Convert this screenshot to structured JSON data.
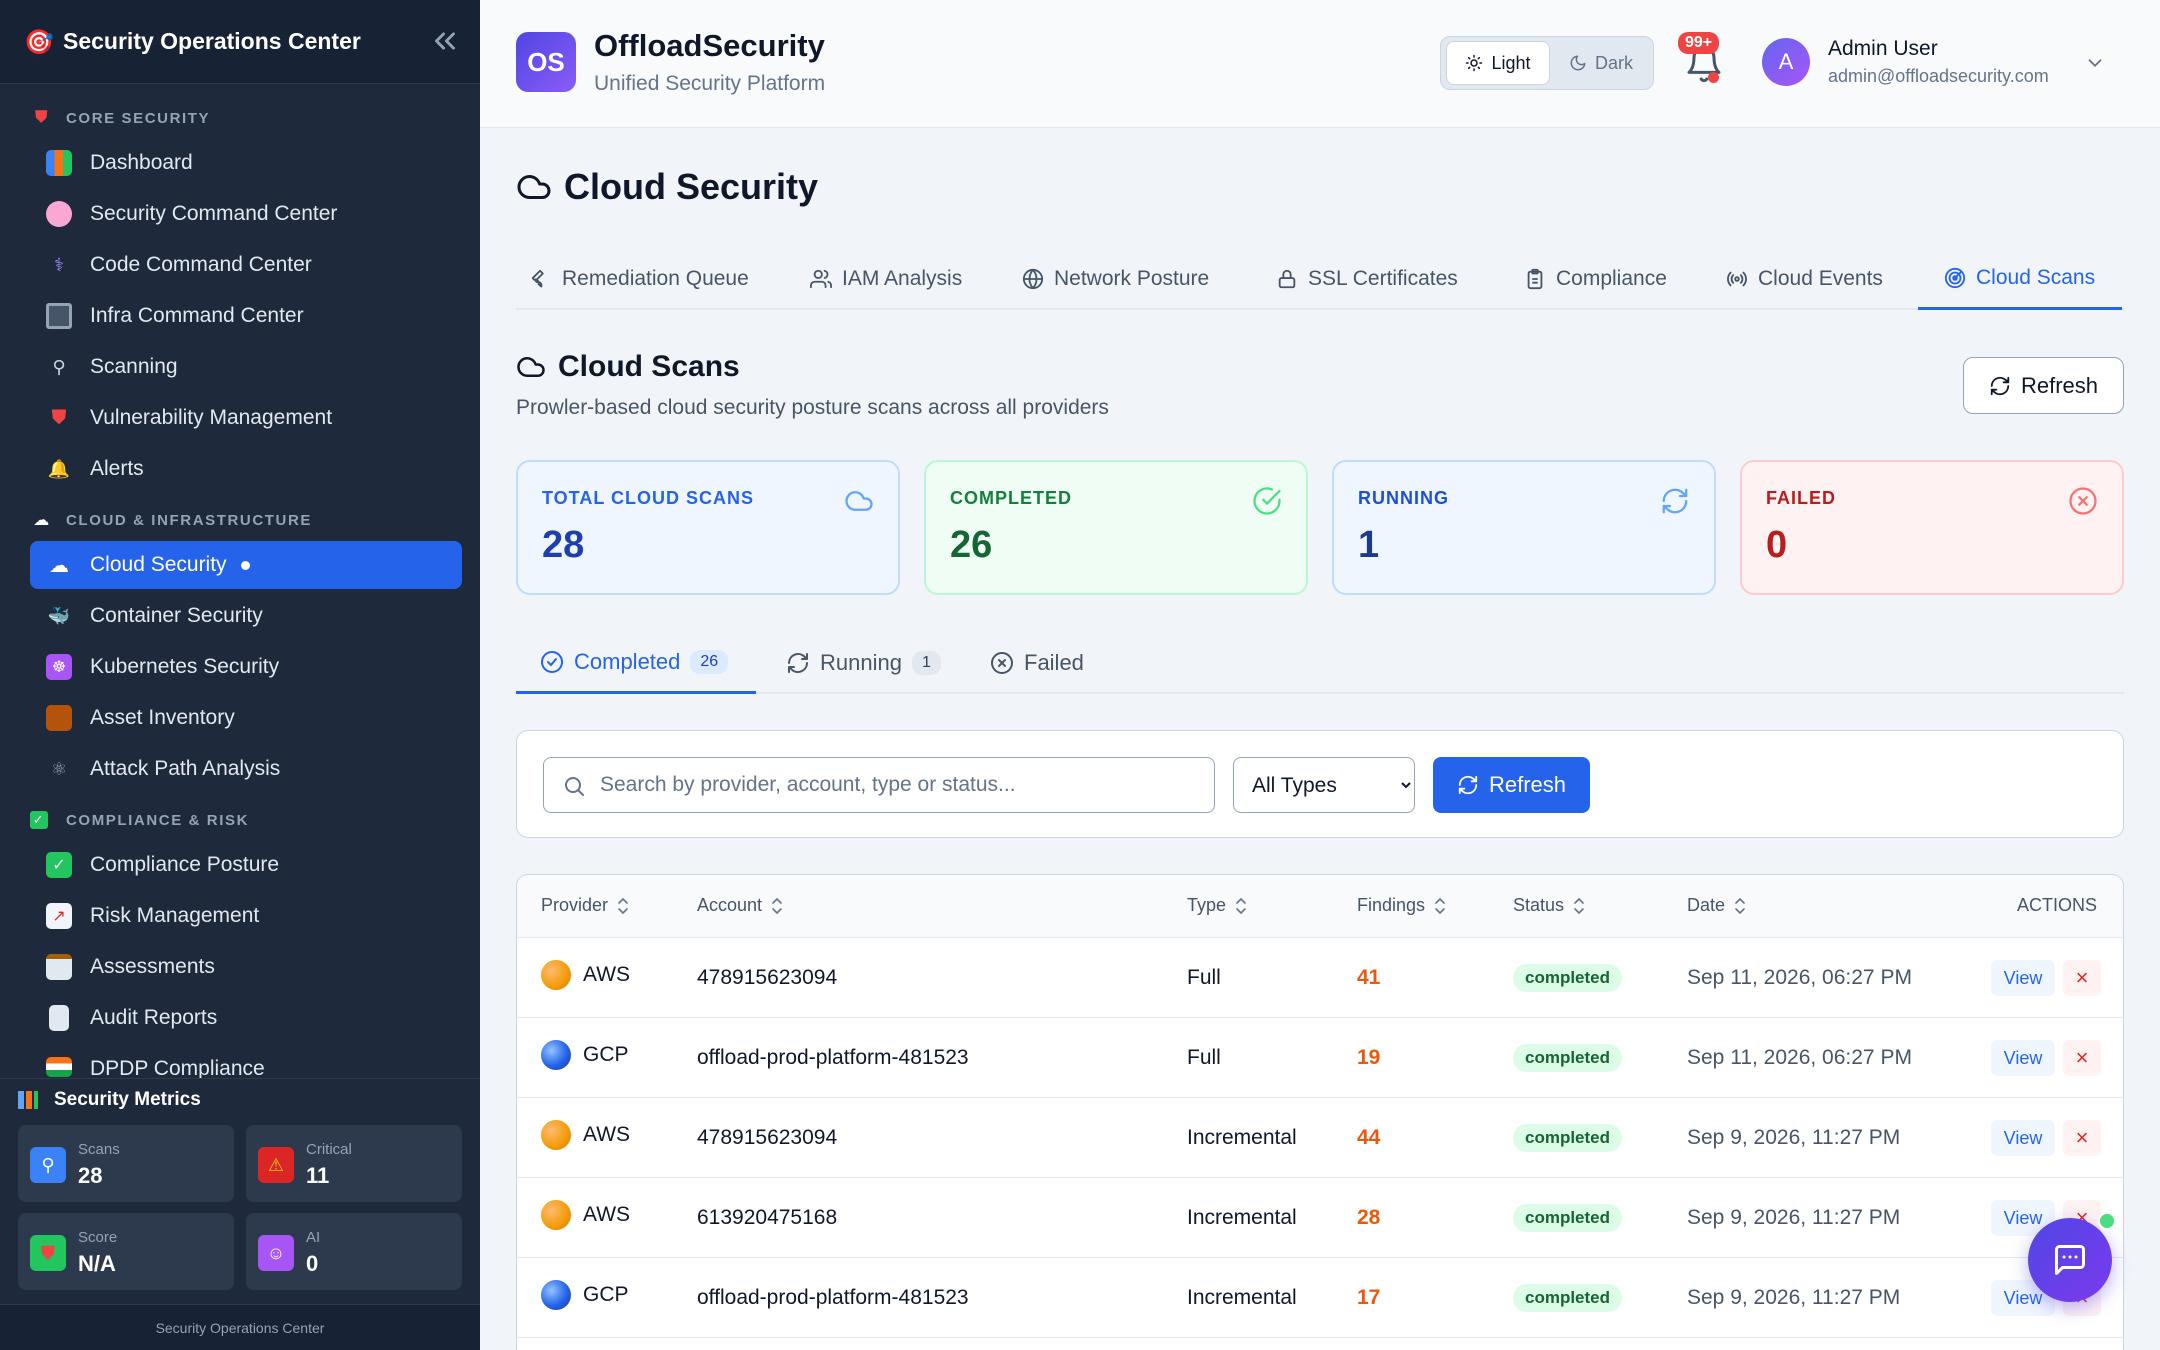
{
  "sidebar": {
    "title": "Security Operations Center",
    "sections": {
      "core": "CORE SECURITY",
      "cloud": "CLOUD & INFRASTRUCTURE",
      "compliance": "COMPLIANCE & RISK"
    },
    "items": [
      {
        "label": "Dashboard",
        "icon": "bar-chart-icon"
      },
      {
        "label": "Security Command Center",
        "icon": "brain-icon"
      },
      {
        "label": "Code Command Center",
        "icon": "dna-icon"
      },
      {
        "label": "Infra Command Center",
        "icon": "monitor-icon"
      },
      {
        "label": "Scanning",
        "icon": "magnifier-icon"
      },
      {
        "label": "Vulnerability Management",
        "icon": "shield-icon"
      },
      {
        "label": "Alerts",
        "icon": "bell-icon"
      },
      {
        "label": "Cloud Security",
        "icon": "cloud-icon"
      },
      {
        "label": "Container Security",
        "icon": "whale-icon"
      },
      {
        "label": "Kubernetes Security",
        "icon": "helm-icon"
      },
      {
        "label": "Asset Inventory",
        "icon": "package-icon"
      },
      {
        "label": "Attack Path Analysis",
        "icon": "atom-icon"
      },
      {
        "label": "Compliance Posture",
        "icon": "check-icon"
      },
      {
        "label": "Risk Management",
        "icon": "trend-chart-icon"
      },
      {
        "label": "Assessments",
        "icon": "clipboard-icon"
      },
      {
        "label": "Audit Reports",
        "icon": "document-icon"
      },
      {
        "label": "DPDP Compliance",
        "icon": "india-flag-icon"
      }
    ],
    "metrics": {
      "title": "Security Metrics",
      "scans_label": "Scans",
      "scans_value": "28",
      "critical_label": "Critical",
      "critical_value": "11",
      "score_label": "Score",
      "score_value": "N/A",
      "ai_label": "AI",
      "ai_value": "0"
    },
    "footer": "Security Operations Center"
  },
  "header": {
    "badge": "OS",
    "brand": "OffloadSecurity",
    "subtitle": "Unified Security Platform",
    "theme_light": "Light",
    "theme_dark": "Dark",
    "notif_count": "99+",
    "user_initial": "A",
    "user_name": "Admin User",
    "user_email": "admin@offloadsecurity.com"
  },
  "main": {
    "title": "Cloud Security",
    "tabs": [
      {
        "label": "Remediation Queue",
        "icon": "wrench-icon"
      },
      {
        "label": "IAM Analysis",
        "icon": "users-icon"
      },
      {
        "label": "Network Posture",
        "icon": "globe-icon"
      },
      {
        "label": "SSL Certificates",
        "icon": "lock-icon"
      },
      {
        "label": "Compliance",
        "icon": "clipboard-icon"
      },
      {
        "label": "Cloud Events",
        "icon": "radio-icon"
      },
      {
        "label": "Cloud Scans",
        "icon": "radar-icon"
      }
    ],
    "section_title": "Cloud Scans",
    "section_desc": "Prowler-based cloud security posture scans across all providers",
    "refresh_label": "Refresh",
    "stats": {
      "total_label": "TOTAL CLOUD SCANS",
      "total_value": "28",
      "completed_label": "COMPLETED",
      "completed_value": "26",
      "running_label": "RUNNING",
      "running_value": "1",
      "failed_label": "FAILED",
      "failed_value": "0"
    },
    "subtabs": {
      "completed_label": "Completed",
      "completed_count": "26",
      "running_label": "Running",
      "running_count": "1",
      "failed_label": "Failed"
    },
    "search_placeholder": "Search by provider, account, type or status...",
    "type_filter": "All Types",
    "filter_refresh": "Refresh",
    "columns": {
      "provider": "Provider",
      "account": "Account",
      "type": "Type",
      "findings": "Findings",
      "status": "Status",
      "date": "Date",
      "actions": "ACTIONS"
    },
    "rows": [
      {
        "provider": "AWS",
        "account": "478915623094",
        "type": "Full",
        "findings": "41",
        "status": "completed",
        "date": "Sep 11, 2026, 06:27 PM",
        "view": "View"
      },
      {
        "provider": "GCP",
        "account": "offload-prod-platform-481523",
        "type": "Full",
        "findings": "19",
        "status": "completed",
        "date": "Sep 11, 2026, 06:27 PM",
        "view": "View"
      },
      {
        "provider": "AWS",
        "account": "478915623094",
        "type": "Incremental",
        "findings": "44",
        "status": "completed",
        "date": "Sep 9, 2026, 11:27 PM",
        "view": "View"
      },
      {
        "provider": "AWS",
        "account": "613920475168",
        "type": "Incremental",
        "findings": "28",
        "status": "completed",
        "date": "Sep 9, 2026, 11:27 PM",
        "view": "View"
      },
      {
        "provider": "GCP",
        "account": "offload-prod-platform-481523",
        "type": "Incremental",
        "findings": "17",
        "status": "completed",
        "date": "Sep 9, 2026, 11:27 PM",
        "view": "View"
      }
    ]
  }
}
